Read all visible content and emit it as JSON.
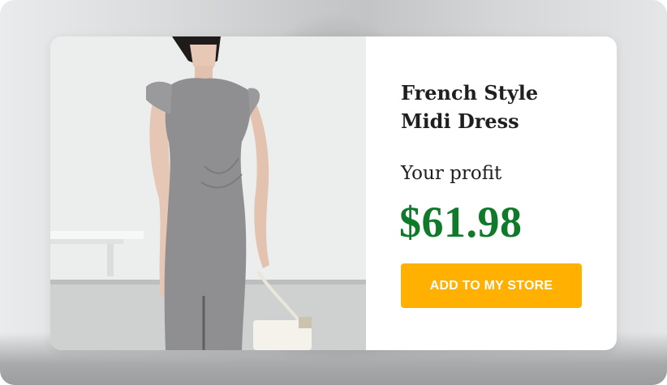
{
  "product": {
    "title_line1": "French Style",
    "title_line2": "Midi Dress",
    "profit_label": "Your profit",
    "profit_value": "$61.98",
    "cta_label": "ADD TO MY STORE",
    "image_alt": "model wearing gray midi dress"
  },
  "colors": {
    "price": "#0f7a2a",
    "cta_background": "#ffb000",
    "cta_text": "#ffffff",
    "dress": "#8f8f91"
  }
}
